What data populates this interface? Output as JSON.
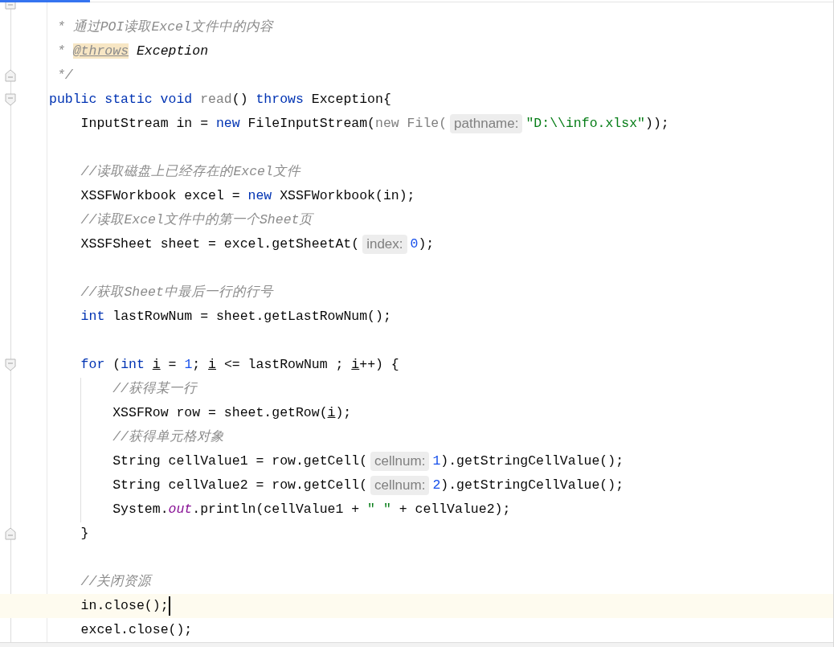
{
  "editor": {
    "lines": [
      {
        "kind": "code",
        "fold_end": true
      },
      {
        "kind": "code",
        "tokens": [
          {
            "kind": "doc",
            "t": " * 通过POI读取Excel文件中的内容"
          }
        ]
      },
      {
        "kind": "code",
        "tokens": [
          {
            "kind": "doc",
            "t": " * "
          },
          {
            "kind": "tag",
            "t": "@throws"
          },
          {
            "kind": "docref",
            "t": " Exception"
          }
        ]
      },
      {
        "kind": "code",
        "fold_end": true,
        "tokens": [
          {
            "kind": "doc",
            "t": " */"
          }
        ]
      },
      {
        "kind": "code",
        "fold_start": true,
        "tokens": [
          {
            "kind": "kw",
            "t": "public static void "
          },
          {
            "kind": "unused",
            "t": "read"
          },
          {
            "kind": "plain",
            "t": "() "
          },
          {
            "kind": "kw",
            "t": "throws"
          },
          {
            "kind": "plain",
            "t": " Exception{"
          }
        ]
      },
      {
        "kind": "code",
        "tokens": [
          {
            "kind": "plain",
            "t": "    InputStream in = "
          },
          {
            "kind": "kw",
            "t": "new"
          },
          {
            "kind": "plain",
            "t": " FileInputStream("
          },
          {
            "kind": "unused",
            "t": "new File("
          },
          {
            "kind": "hint",
            "t": "pathname:"
          },
          {
            "kind": "str",
            "t": "\"D:\\\\info.xlsx\""
          },
          {
            "kind": "plain",
            "t": "));"
          }
        ]
      },
      {
        "kind": "blank"
      },
      {
        "kind": "code",
        "tokens": [
          {
            "kind": "comment",
            "t": "    //读取磁盘上已经存在的Excel文件"
          }
        ]
      },
      {
        "kind": "code",
        "tokens": [
          {
            "kind": "plain",
            "t": "    XSSFWorkbook excel = "
          },
          {
            "kind": "kw",
            "t": "new"
          },
          {
            "kind": "plain",
            "t": " XSSFWorkbook(in);"
          }
        ]
      },
      {
        "kind": "code",
        "tokens": [
          {
            "kind": "comment",
            "t": "    //读取Excel文件中的第一个Sheet页"
          }
        ]
      },
      {
        "kind": "code",
        "tokens": [
          {
            "kind": "plain",
            "t": "    XSSFSheet sheet = excel.getSheetAt("
          },
          {
            "kind": "hint",
            "t": "index:"
          },
          {
            "kind": "num",
            "t": "0"
          },
          {
            "kind": "plain",
            "t": ");"
          }
        ]
      },
      {
        "kind": "blank"
      },
      {
        "kind": "code",
        "tokens": [
          {
            "kind": "comment",
            "t": "    //获取Sheet中最后一行的行号"
          }
        ]
      },
      {
        "kind": "code",
        "tokens": [
          {
            "kind": "kw",
            "t": "    int"
          },
          {
            "kind": "plain",
            "t": " lastRowNum = sheet.getLastRowNum();"
          }
        ]
      },
      {
        "kind": "blank"
      },
      {
        "kind": "code",
        "fold_start": true,
        "tokens": [
          {
            "kind": "kw",
            "t": "    for"
          },
          {
            "kind": "plain",
            "t": " ("
          },
          {
            "kind": "kw",
            "t": "int "
          },
          {
            "kind": "var",
            "t": "i"
          },
          {
            "kind": "plain",
            "t": " = "
          },
          {
            "kind": "num",
            "t": "1"
          },
          {
            "kind": "plain",
            "t": "; "
          },
          {
            "kind": "var",
            "t": "i"
          },
          {
            "kind": "plain",
            "t": " <= lastRowNum ; "
          },
          {
            "kind": "var",
            "t": "i"
          },
          {
            "kind": "plain",
            "t": "++) {"
          }
        ]
      },
      {
        "kind": "code",
        "tokens": [
          {
            "kind": "comment",
            "t": "        //获得某一行"
          }
        ]
      },
      {
        "kind": "code",
        "tokens": [
          {
            "kind": "plain",
            "t": "        XSSFRow row = sheet.getRow("
          },
          {
            "kind": "var",
            "t": "i"
          },
          {
            "kind": "plain",
            "t": ");"
          }
        ]
      },
      {
        "kind": "code",
        "tokens": [
          {
            "kind": "comment",
            "t": "        //获得单元格对象"
          }
        ]
      },
      {
        "kind": "code",
        "tokens": [
          {
            "kind": "plain",
            "t": "        String cellValue1 = row.getCell("
          },
          {
            "kind": "hint",
            "t": "cellnum:"
          },
          {
            "kind": "num",
            "t": "1"
          },
          {
            "kind": "plain",
            "t": ").getStringCellValue();"
          }
        ]
      },
      {
        "kind": "code",
        "tokens": [
          {
            "kind": "plain",
            "t": "        String cellValue2 = row.getCell("
          },
          {
            "kind": "hint",
            "t": "cellnum:"
          },
          {
            "kind": "num",
            "t": "2"
          },
          {
            "kind": "plain",
            "t": ").getStringCellValue();"
          }
        ]
      },
      {
        "kind": "code",
        "tokens": [
          {
            "kind": "plain",
            "t": "        System."
          },
          {
            "kind": "static",
            "t": "out"
          },
          {
            "kind": "plain",
            "t": ".println(cellValue1 + "
          },
          {
            "kind": "str",
            "t": "\" \""
          },
          {
            "kind": "plain",
            "t": " + cellValue2);"
          }
        ]
      },
      {
        "kind": "code",
        "fold_end": true,
        "tokens": [
          {
            "kind": "plain",
            "t": "    }"
          }
        ]
      },
      {
        "kind": "blank"
      },
      {
        "kind": "code",
        "tokens": [
          {
            "kind": "comment",
            "t": "    //关闭资源"
          }
        ]
      },
      {
        "kind": "code",
        "current": true,
        "caret": true,
        "tokens": [
          {
            "kind": "plain",
            "t": "    in.close();"
          }
        ]
      },
      {
        "kind": "code",
        "tokens": [
          {
            "kind": "plain",
            "t": "    excel.close();"
          }
        ]
      }
    ]
  }
}
